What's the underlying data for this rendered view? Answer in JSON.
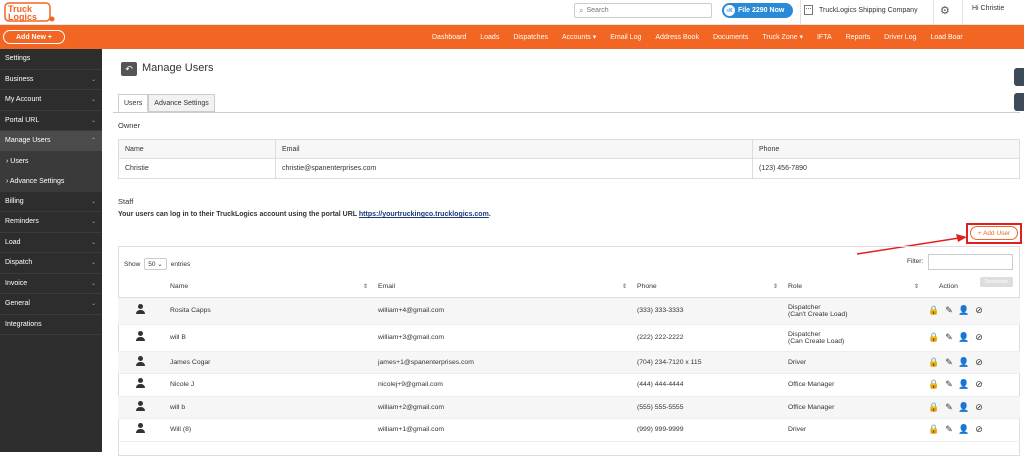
{
  "logo": {
    "text": "Truck Logics"
  },
  "search": {
    "placeholder": "Search"
  },
  "file_button": {
    "label": "File 2290 Now",
    "badge": "≡K"
  },
  "company": "TruckLogics Shipping Company",
  "greeting": "Hi Christie",
  "add_new": "Add New  +",
  "nav": [
    "Dashboard",
    "Loads",
    "Dispatches",
    "Accounts ▾",
    "Email Log",
    "Address Book",
    "Documents",
    "Truck Zone ▾",
    "IFTA",
    "Reports",
    "Driver Log",
    "Load Boar"
  ],
  "sidebar": [
    {
      "label": "Settings",
      "chev": ""
    },
    {
      "label": "Business",
      "chev": "⌄"
    },
    {
      "label": "My Account",
      "chev": "⌄"
    },
    {
      "label": "Portal URL",
      "chev": "⌄"
    },
    {
      "label": "Manage Users",
      "chev": "⌃"
    },
    {
      "label": "› Users",
      "sub": true
    },
    {
      "label": "› Advance Settings",
      "sub": true
    },
    {
      "label": "Billing",
      "chev": "⌄"
    },
    {
      "label": "Reminders",
      "chev": "⌄"
    },
    {
      "label": "Load",
      "chev": "⌄"
    },
    {
      "label": "Dispatch",
      "chev": "⌄"
    },
    {
      "label": "Invoice",
      "chev": "⌄"
    },
    {
      "label": "General",
      "chev": "⌄"
    },
    {
      "label": "Integrations",
      "chev": ""
    }
  ],
  "page_title": "Manage Users",
  "tabs": {
    "users": "Users",
    "advance": "Advance Settings"
  },
  "owner": {
    "label": "Owner",
    "headers": [
      "Name",
      "Email",
      "Phone"
    ],
    "row": [
      "Christie",
      "christie@spanenterprises.com",
      "(123) 456-7890"
    ]
  },
  "staff": {
    "label": "Staff",
    "portal_text": "Your users can log in to their TruckLogics account using the portal URL ",
    "portal_url": "https://yourtruckingco.trucklogics.com",
    "add_user": "+ Add User",
    "show": "Show",
    "show_value": "50",
    "entries": "entries",
    "filter": "Filter:",
    "deactivate": "Deactivate",
    "headers": [
      "Name",
      "Email",
      "Phone",
      "Role",
      "Action"
    ],
    "rows": [
      {
        "name": "Rosita Capps",
        "email": "william+4@gmail.com",
        "phone": "(333) 333-3333",
        "role": "Dispatcher",
        "role2": "(Can't Create Load)"
      },
      {
        "name": "will B",
        "email": "william+3@gmail.com",
        "phone": "(222) 222-2222",
        "role": "Dispatcher",
        "role2": "(Can Create Load)"
      },
      {
        "name": "James Cogar",
        "email": "james+1@spanenterprises.com",
        "phone": "(704) 234-7120 x 115",
        "role": "Driver",
        "role2": ""
      },
      {
        "name": "Nicole J",
        "email": "nicolej+9@gmail.com",
        "phone": "(444) 444-4444",
        "role": "Office Manager",
        "role2": ""
      },
      {
        "name": "will b",
        "email": "william+2@gmail.com",
        "phone": "(555) 555-5555",
        "role": "Office Manager",
        "role2": ""
      },
      {
        "name": "Will (8)",
        "email": "william+1@gmail.com",
        "phone": "(999) 999-9999",
        "role": "Driver",
        "role2": ""
      }
    ]
  }
}
